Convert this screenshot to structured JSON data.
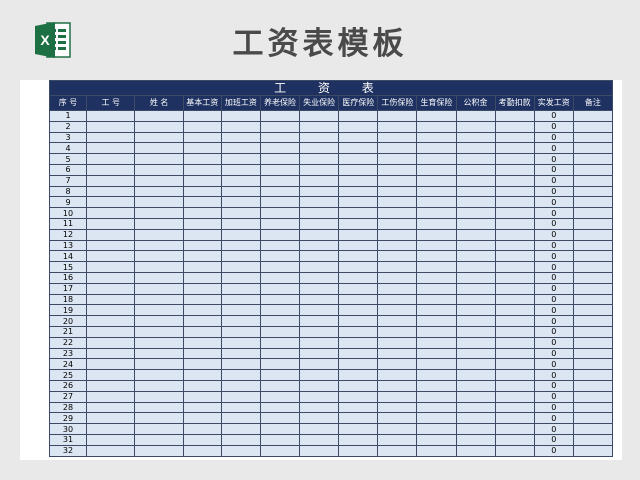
{
  "page": {
    "title": "工资表模板"
  },
  "app_icon": {
    "letter": "X"
  },
  "sheet": {
    "title": "工 资 表",
    "headers": [
      "序 号",
      "工 号",
      "姓 名",
      "基本工资",
      "加班工资",
      "养老保险",
      "失业保险",
      "医疗保险",
      "工伤保险",
      "生育保险",
      "公积金",
      "考勤扣款",
      "实发工资",
      "备注"
    ],
    "rows": [
      {
        "no": "1",
        "net": "0"
      },
      {
        "no": "2",
        "net": "0"
      },
      {
        "no": "3",
        "net": "0"
      },
      {
        "no": "4",
        "net": "0"
      },
      {
        "no": "5",
        "net": "0"
      },
      {
        "no": "6",
        "net": "0"
      },
      {
        "no": "7",
        "net": "0"
      },
      {
        "no": "8",
        "net": "0"
      },
      {
        "no": "9",
        "net": "0"
      },
      {
        "no": "10",
        "net": "0"
      },
      {
        "no": "11",
        "net": "0"
      },
      {
        "no": "12",
        "net": "0"
      },
      {
        "no": "13",
        "net": "0"
      },
      {
        "no": "14",
        "net": "0"
      },
      {
        "no": "15",
        "net": "0"
      },
      {
        "no": "16",
        "net": "0"
      },
      {
        "no": "17",
        "net": "0"
      },
      {
        "no": "18",
        "net": "0"
      },
      {
        "no": "19",
        "net": "0"
      },
      {
        "no": "20",
        "net": "0"
      },
      {
        "no": "21",
        "net": "0"
      },
      {
        "no": "22",
        "net": "0"
      },
      {
        "no": "23",
        "net": "0"
      },
      {
        "no": "24",
        "net": "0"
      },
      {
        "no": "25",
        "net": "0"
      },
      {
        "no": "26",
        "net": "0"
      },
      {
        "no": "27",
        "net": "0"
      },
      {
        "no": "28",
        "net": "0"
      },
      {
        "no": "29",
        "net": "0"
      },
      {
        "no": "30",
        "net": "0"
      },
      {
        "no": "31",
        "net": "0"
      },
      {
        "no": "32",
        "net": "0"
      }
    ]
  },
  "colors": {
    "header_bg": "#1e3160",
    "cell_bg": "#dce6f2",
    "excel_green": "#1d7044"
  }
}
